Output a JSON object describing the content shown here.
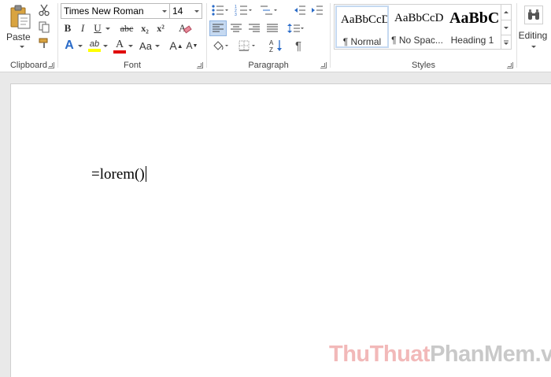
{
  "clipboard": {
    "paste_label": "Paste",
    "group_label": "Clipboard"
  },
  "font": {
    "name": "Times New Roman",
    "size": "14",
    "bold": "B",
    "italic": "I",
    "underline": "U",
    "strikethrough": "abc",
    "subscript": "x₂",
    "superscript": "x²",
    "text_effects": "A",
    "highlight": "ab",
    "font_color": "A",
    "change_case": "Aa",
    "grow": "A",
    "shrink": "A",
    "group_label": "Font",
    "highlight_color": "#ffff00",
    "font_color_value": "#e00000"
  },
  "paragraph": {
    "group_label": "Paragraph",
    "pilcrow": "¶"
  },
  "styles": {
    "group_label": "Styles",
    "items": [
      {
        "sample": "AaBbCcDc",
        "name": "¶ Normal"
      },
      {
        "sample": "AaBbCcDc",
        "name": "¶ No Spac..."
      },
      {
        "sample": "AaBbCc",
        "name": "Heading 1"
      }
    ]
  },
  "editing": {
    "label": "Editing"
  },
  "document": {
    "text": "=lorem()"
  },
  "watermark": {
    "part1": "ThuThuat",
    "part2": "PhanMem",
    "part3": ".vn"
  }
}
